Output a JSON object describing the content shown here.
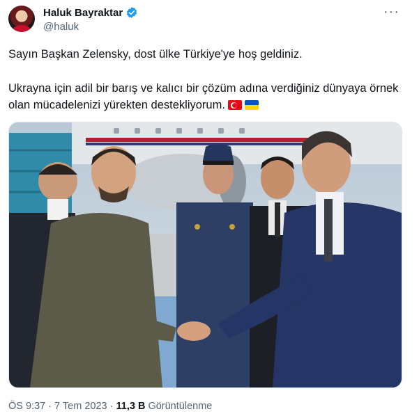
{
  "author": {
    "name": "Haluk Bayraktar",
    "handle": "@haluk",
    "verified_icon": "verified-badge-icon",
    "avatar_icon": "avatar"
  },
  "menu": {
    "label": "···"
  },
  "tweet": {
    "line1": "Sayın Başkan Zelensky, dost ülke Türkiye'ye hoş geldiniz.",
    "line2": "Ukrayna için adil bir barış ve kalıcı bir çözüm adına verdiğiniz dünyaya örnek olan mücadelenizi yürekten destekliyorum.",
    "flags": [
      "turkey-flag-icon",
      "ukraine-flag-icon"
    ]
  },
  "meta": {
    "time": "ÖS 9:37",
    "date": "7 Tem 2023",
    "sep": " · ",
    "views_count": "11,3 B",
    "views_label": " Görüntülenme"
  },
  "colors": {
    "text": "#0f1419",
    "muted": "#536471",
    "verified": "#1d9bf0"
  }
}
